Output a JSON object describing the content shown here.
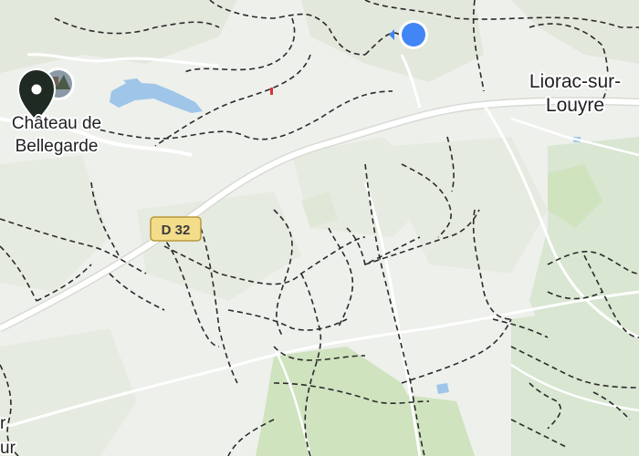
{
  "map": {
    "colors": {
      "land": "#eef0ec",
      "woodland_light": "#e3e8dd",
      "woodland": "#d9e6d2",
      "green_area": "#cfe3bf",
      "water": "#9fc6e8",
      "road": "#ffffff",
      "trail": "#2b2b2b",
      "location_dot": "#4285f4",
      "pin": "#1e2a22",
      "shield_fill": "#f3dc8a"
    },
    "labels": {
      "chateau_line1": "Château de",
      "chateau_line2": "Bellegarde",
      "town_line1": "Liorac-sur-",
      "town_line2": "Louyre",
      "edge_fragment_1": "r",
      "edge_fragment_2": "ur"
    },
    "road_shield": {
      "label": "D 32"
    },
    "icons": {
      "place_pin": "location-pin-icon",
      "place_photo": "chateau-photo-thumbnail",
      "current_location": "current-location-dot-icon",
      "heading": "heading-arrow-icon"
    }
  }
}
